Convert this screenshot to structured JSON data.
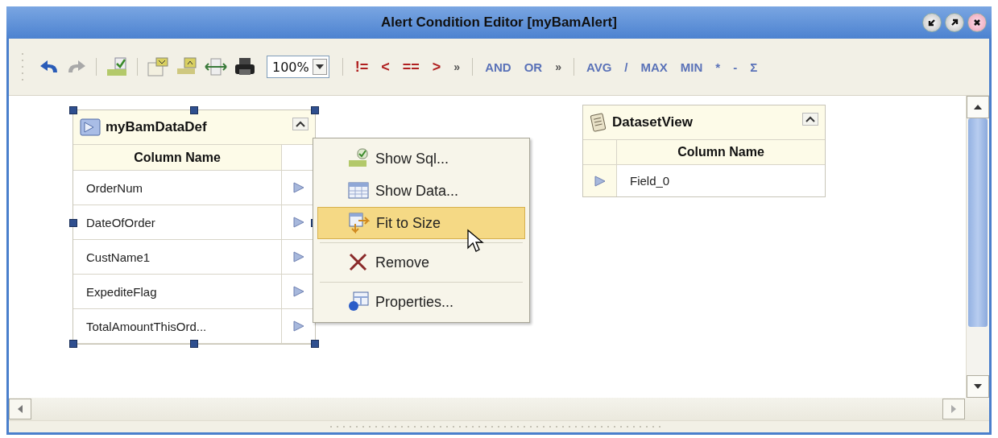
{
  "window": {
    "title": "Alert Condition Editor [myBamAlert]"
  },
  "toolbar": {
    "zoom_value": "100%",
    "comparison_ops": [
      "!=",
      "<",
      "==",
      ">"
    ],
    "more_1": "»",
    "logic_ops": [
      "AND",
      "OR"
    ],
    "more_2": "»",
    "aggregate_ops": [
      "AVG",
      "/",
      "MAX",
      "MIN",
      "*",
      "-",
      "Σ"
    ]
  },
  "tables": [
    {
      "kind": "source",
      "title": "myBamDataDef",
      "column_header": "Column Name",
      "selected": true,
      "rows": [
        "OrderNum",
        "DateOfOrder",
        "CustName1",
        "ExpediteFlag",
        "TotalAmountThisOrd..."
      ]
    },
    {
      "kind": "target",
      "title": "DatasetView",
      "column_header": "Column Name",
      "selected": false,
      "rows": [
        "Field_0"
      ]
    }
  ],
  "context_menu": {
    "items": [
      {
        "kind": "sql",
        "label": "Show Sql...",
        "selected": false
      },
      {
        "kind": "data",
        "label": "Show Data...",
        "selected": false
      },
      {
        "kind": "fit",
        "label": "Fit to Size",
        "selected": true
      },
      {
        "kind": "separator"
      },
      {
        "kind": "remove",
        "label": "Remove",
        "selected": false
      },
      {
        "kind": "separator"
      },
      {
        "kind": "properties",
        "label": "Properties...",
        "selected": false
      }
    ]
  }
}
